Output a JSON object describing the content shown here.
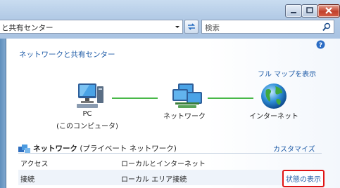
{
  "window": {
    "address_text": "と共有センター",
    "search_placeholder": "検索",
    "colors": {
      "accent": "#1d5aa6",
      "connection": "#48b848",
      "highlight": "#e01414"
    }
  },
  "page": {
    "title": "ネットワークと共有センター",
    "full_map_link": "フル マップを表示"
  },
  "network_map": {
    "nodes": [
      {
        "label_line1": "PC",
        "label_line2": "(このコンピュータ)",
        "icon": "computer-icon"
      },
      {
        "label_line1": "ネットワーク",
        "label_line2": "",
        "icon": "network-icon"
      },
      {
        "label_line1": "インターネット",
        "label_line2": "",
        "icon": "globe-icon"
      }
    ]
  },
  "network_section": {
    "title_bold": "ネットワーク",
    "title_rest": " (プライベート ネットワーク)",
    "customize_link": "カスタマイズ",
    "rows": [
      {
        "label": "アクセス",
        "value": "ローカルとインターネット",
        "action": ""
      },
      {
        "label": "接続",
        "value": "ローカル エリア接続",
        "action": "状態の表示"
      }
    ]
  }
}
